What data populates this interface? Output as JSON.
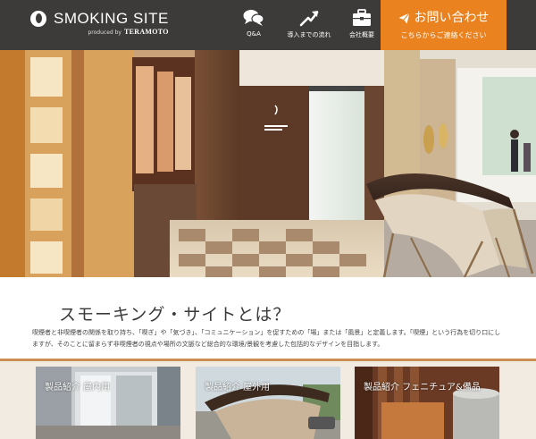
{
  "header": {
    "logo_title": "SMOKING SITE",
    "logo_produced_by": "produced by",
    "logo_brand": "TERAMOTO",
    "nav": [
      {
        "label": "Q&A",
        "icon": "chat-bubbles-icon"
      },
      {
        "label": "導入までの流れ",
        "icon": "flow-arrow-icon"
      },
      {
        "label": "会社概要",
        "icon": "briefcase-icon"
      }
    ],
    "contact": {
      "label": "お問い合わせ",
      "sublabel": "こちらからご連絡ください",
      "icon": "paper-plane-icon",
      "color": "#e9821f"
    }
  },
  "intro": {
    "title": "スモーキング・サイトとは？",
    "body": "喫煙者と非喫煙者の関係を取り持ち、「喫ぎ」や「気づき」、「コミュニケーション」を促すための「場」または「風景」と定義します。「喫煙」という行為を切り口にしますが、そのことに留まらず非喫煙者の視点や場所の文脈など総合的な環境/景観を考慮した包括的なデザインを目指します。"
  },
  "products": [
    {
      "label": "製品紹介 屋内用"
    },
    {
      "label": "製品紹介 屋外用"
    },
    {
      "label": "製品紹介 フェニチュア&備品"
    }
  ],
  "colors": {
    "header_bg": "#3d3b39",
    "accent": "#e9821f",
    "divider": "#c98f55",
    "products_bg": "#f1ebe1"
  }
}
